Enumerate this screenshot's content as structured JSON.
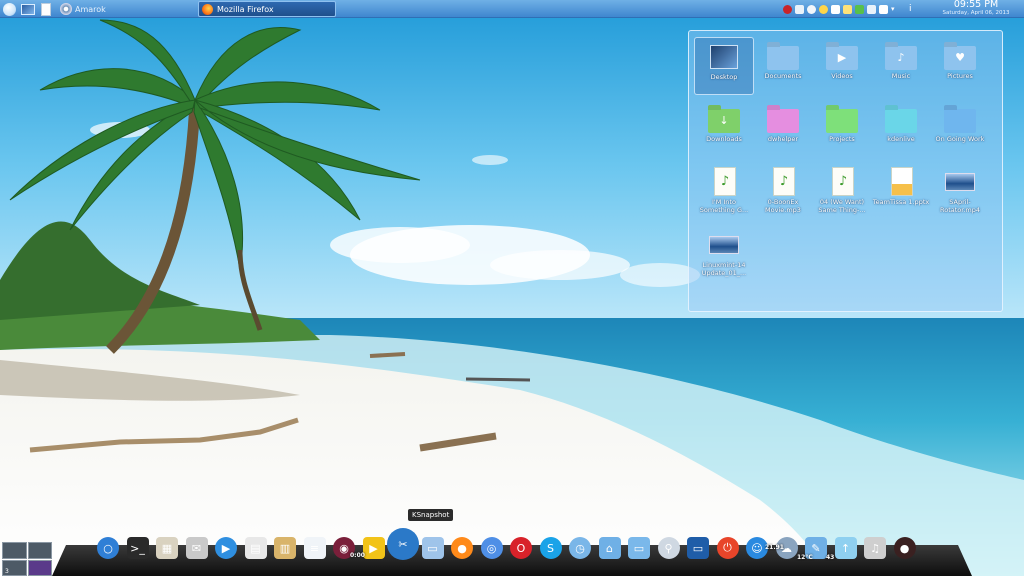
{
  "top_panel": {
    "tasks": {
      "amarok": "Amarok",
      "firefox": "Mozilla Firefox"
    },
    "clock": {
      "time": "09:55 PM",
      "date": "Saturday, April 06, 2013"
    }
  },
  "folder_view": {
    "items": [
      {
        "label": "Desktop",
        "kind": "desktop"
      },
      {
        "label": "Documents",
        "kind": "folder",
        "color": "#8ec3ee"
      },
      {
        "label": "Videos",
        "kind": "folder",
        "color": "#8ec3ee",
        "icon": "clapper-icon"
      },
      {
        "label": "Music",
        "kind": "folder",
        "color": "#8ec3ee",
        "icon": "music-note-icon"
      },
      {
        "label": "Pictures",
        "kind": "folder",
        "color": "#8ec3ee",
        "icon": "heart-icon"
      },
      {
        "label": "Downloads",
        "kind": "folder",
        "color": "#7fd06a",
        "icon": "download-arrow-icon"
      },
      {
        "label": "dwhelper",
        "kind": "folder",
        "color": "#e58ee0"
      },
      {
        "label": "Projects",
        "kind": "folder",
        "color": "#7ee07a"
      },
      {
        "label": "kdenlive",
        "kind": "folder",
        "color": "#6ad6e8"
      },
      {
        "label": "On Going Work",
        "kind": "folder",
        "color": "#6fb6ee"
      },
      {
        "label": "I'M Into Something G...",
        "kind": "audio"
      },
      {
        "label": "0-BoonEx Movie.mp3",
        "kind": "audio"
      },
      {
        "label": "04 (We Want) Same Thing-...",
        "kind": "audio"
      },
      {
        "label": "TeamTissa 1.pptx",
        "kind": "presentation"
      },
      {
        "label": "SApril-Rotator.mp4",
        "kind": "video"
      },
      {
        "label": "Linuxmint-14 Update_01_...",
        "kind": "video"
      }
    ]
  },
  "tooltip": "KSnapshot",
  "dock": {
    "icons": [
      "kde-menu-icon",
      "terminal-icon",
      "software-package-icon",
      "mail-bird-icon",
      "media-player-icon",
      "calculator-icon",
      "archive-icon",
      "text-editor-icon",
      "amarok-icon",
      "video-player-icon",
      "ksnapshot-icon",
      "scanner-icon",
      "firefox-icon",
      "chromium-icon",
      "opera-icon",
      "skype-icon",
      "clock-icon",
      "home-folder-icon",
      "folder-icon",
      "search-icon",
      "monitor-icon",
      "power-icon",
      "accessibility-icon",
      "weather-icon",
      "chat-icon",
      "upload-icon",
      "microphone-icon",
      "settings-icon"
    ],
    "badges": {
      "video_time": "0:00",
      "temperature": "12°C",
      "count": "43",
      "download": "21.91"
    }
  },
  "pager": {
    "current": "3"
  },
  "colors": {
    "panel_top": "#6fb0e6",
    "panel_bottom": "#3f86cf",
    "dock": "#1a1a1a",
    "folder_default": "#8ec3ee"
  }
}
